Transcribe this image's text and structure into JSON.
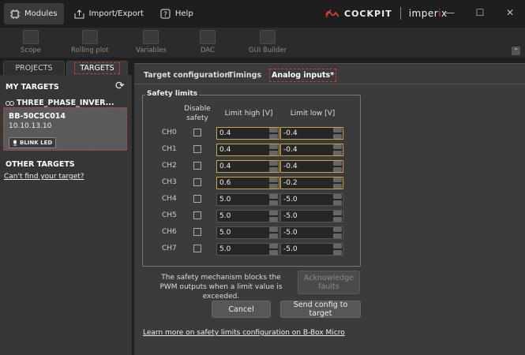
{
  "titlebar": {
    "modules": "Modules",
    "import_export": "Import/Export",
    "help": "Help",
    "brand": "COCKPIT",
    "brand2_a": "imper",
    "brand2_b": "i",
    "brand2_c": "x",
    "minimize": "—",
    "maximize": "☐",
    "close": "✕"
  },
  "ribbon": {
    "items": [
      "Scope",
      "Rolling plot",
      "Variables",
      "DAC",
      "GUI Builder"
    ],
    "collapse": "⌃"
  },
  "left": {
    "tabs": [
      "PROJECTS",
      "TARGETS"
    ],
    "my_targets": "MY TARGETS",
    "refresh": "⟳",
    "project_name": "THREE_PHASE_INVER...",
    "target_name": "BB-50C5C014",
    "target_ip": "10.10.13.10",
    "blink": "BLINK LED",
    "other_targets": "OTHER TARGETS",
    "cant_find": "Can't find your target?"
  },
  "main": {
    "tabs": [
      "Target configuration",
      "Timings",
      "Analog inputs*"
    ],
    "legend": "Safety limits",
    "col_disable": "Disable\nsafety",
    "col_high": "Limit high [V]",
    "col_low": "Limit low [V]",
    "channels": [
      {
        "name": "CH0",
        "high": "0.4",
        "low": "-0.4",
        "highlight": true
      },
      {
        "name": "CH1",
        "high": "0.4",
        "low": "-0.4",
        "highlight": true
      },
      {
        "name": "CH2",
        "high": "0.4",
        "low": "-0.4",
        "highlight": true
      },
      {
        "name": "CH3",
        "high": "0.6",
        "low": "-0.2",
        "highlight": true
      },
      {
        "name": "CH4",
        "high": "5.0",
        "low": "-5.0",
        "highlight": false
      },
      {
        "name": "CH5",
        "high": "5.0",
        "low": "-5.0",
        "highlight": false
      },
      {
        "name": "CH6",
        "high": "5.0",
        "low": "-5.0",
        "highlight": false
      },
      {
        "name": "CH7",
        "high": "5.0",
        "low": "-5.0",
        "highlight": false
      }
    ],
    "note": "The safety mechanism blocks the PWM outputs when a limit value is exceeded.",
    "ack": "Acknowledge faults",
    "cancel": "Cancel",
    "send": "Send config to target",
    "link": "Learn more on safety limits configuration on B-Box Micro"
  }
}
